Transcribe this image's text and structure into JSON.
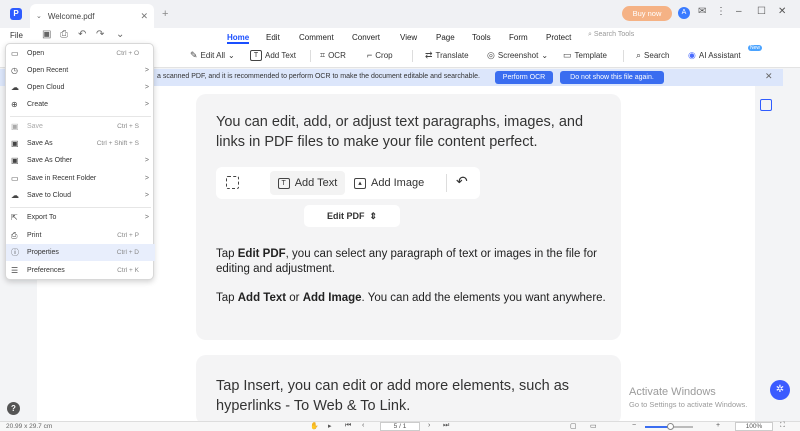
{
  "tab": {
    "title": "Welcome.pdf"
  },
  "header": {
    "buy_label": "Buy now",
    "avatar_letter": "A"
  },
  "menubar": {
    "file_label": "File",
    "tabs": [
      "Home",
      "Edit",
      "Comment",
      "Convert",
      "View",
      "Page",
      "Tools",
      "Form",
      "Protect"
    ],
    "active_tab": "Home",
    "search_placeholder": "Search Tools"
  },
  "toolbar": {
    "edit_all": "Edit All",
    "add_text": "Add Text",
    "ocr": "OCR",
    "crop": "Crop",
    "translate": "Translate",
    "screenshot": "Screenshot",
    "template": "Template",
    "search": "Search",
    "ai_assistant": "AI Assistant",
    "ai_badge": "New"
  },
  "banner": {
    "message": "a scanned PDF, and it is recommended to perform OCR to make the document editable and searchable.",
    "perform_ocr": "Perform OCR",
    "dont_show": "Do not show this file again."
  },
  "file_menu": {
    "items": [
      {
        "label": "Open",
        "shortcut": "Ctrl + O",
        "arrow": "",
        "disabled": false
      },
      {
        "label": "Open Recent",
        "shortcut": "",
        "arrow": ">",
        "disabled": false
      },
      {
        "label": "Open Cloud",
        "shortcut": "",
        "arrow": ">",
        "disabled": false
      },
      {
        "label": "Create",
        "shortcut": "",
        "arrow": ">",
        "disabled": false
      },
      {
        "label": "Save",
        "shortcut": "Ctrl + S",
        "arrow": "",
        "disabled": true
      },
      {
        "label": "Save As",
        "shortcut": "Ctrl + Shift + S",
        "arrow": "",
        "disabled": false
      },
      {
        "label": "Save As Other",
        "shortcut": "",
        "arrow": ">",
        "disabled": false
      },
      {
        "label": "Save in Recent Folder",
        "shortcut": "",
        "arrow": ">",
        "disabled": false
      },
      {
        "label": "Save to Cloud",
        "shortcut": "",
        "arrow": ">",
        "disabled": false
      },
      {
        "label": "Export To",
        "shortcut": "",
        "arrow": ">",
        "disabled": false
      },
      {
        "label": "Print",
        "shortcut": "Ctrl + P",
        "arrow": "",
        "disabled": false
      },
      {
        "label": "Properties",
        "shortcut": "Ctrl + D",
        "arrow": "",
        "disabled": false
      },
      {
        "label": "Preferences",
        "shortcut": "Ctrl + K",
        "arrow": "",
        "disabled": false
      }
    ]
  },
  "document": {
    "heading1": "You can edit, add, or adjust text paragraphs, images, and links in PDF files to make your file content perfect.",
    "demo_add_text": "Add Text",
    "demo_add_image": "Add Image",
    "demo_edit_pdf": "Edit PDF",
    "tap_edit_prefix": "Tap ",
    "tap_edit_bold": "Edit PDF",
    "tap_edit_rest": ", you can  select any paragraph of text or images in the file for editing and adjustment.",
    "tap_add_prefix": "Tap ",
    "tap_add_bold1": "Add Text",
    "tap_add_or": " or ",
    "tap_add_bold2": "Add Image",
    "tap_add_rest": ". You can add the elements you want anywhere.",
    "heading2": "Tap Insert, you can edit or add more elements, such as hyperlinks - To Web & To Link."
  },
  "watermark": {
    "line1": "Activate Windows",
    "line2": "Go to Settings to activate Windows."
  },
  "statusbar": {
    "dimensions": "20.99 x 29.7 cm",
    "page": "5 / 1",
    "zoom": "100%",
    "zoom_fraction": 0.5
  },
  "help_label": "?"
}
